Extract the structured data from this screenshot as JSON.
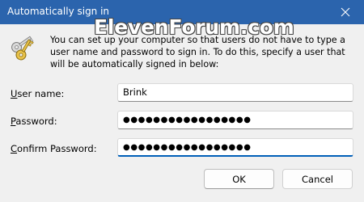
{
  "window": {
    "title": "Automatically sign in",
    "watermark": "ElevenForum.com",
    "close_icon": "close-icon",
    "titlebar_color": "#2b64ad"
  },
  "description": "You can set up your computer so that users do not have to type a user name and password to sign in. To do this, specify a user that will be automatically signed in below:",
  "fields": {
    "username": {
      "label_accel": "U",
      "label_rest": "ser name:",
      "value": "Brink"
    },
    "password": {
      "label_accel": "P",
      "label_rest": "assword:",
      "value": "●●●●●●●●●●●●●●●●●"
    },
    "confirm_password": {
      "label_accel": "C",
      "label_rest": "onfirm Password:",
      "value": "●●●●●●●●●●●●●●●●●"
    }
  },
  "buttons": {
    "ok": "OK",
    "cancel": "Cancel"
  },
  "icons": {
    "keys": "keys-icon"
  }
}
